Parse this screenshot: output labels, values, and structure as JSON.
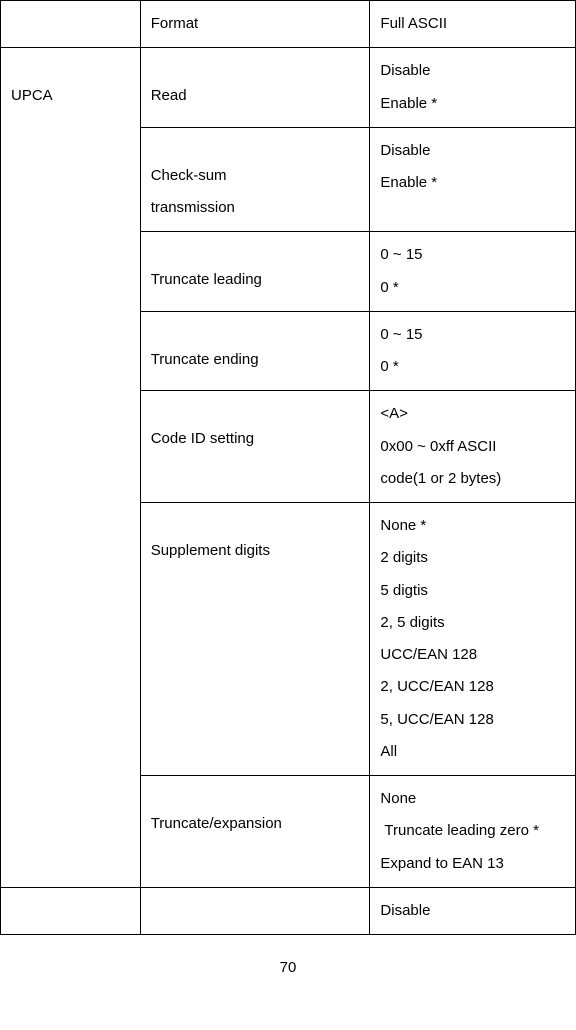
{
  "rows": [
    {
      "col1": "",
      "col2": "Format",
      "col3_lines": [
        " Full ASCII"
      ]
    },
    {
      "col1": "UPCA",
      "col1_rowspan": 7,
      "col2": "Read",
      "col3_lines": [
        "Disable",
        "Enable *"
      ]
    },
    {
      "col2_lines": [
        "Check-sum",
        "transmission"
      ],
      "col3_lines": [
        "Disable",
        "Enable *"
      ]
    },
    {
      "col2": "Truncate leading",
      "col3_lines": [
        "0 ~ 15",
        "0 *"
      ]
    },
    {
      "col2": "Truncate ending",
      "col3_lines": [
        "0 ~ 15",
        "0 *"
      ]
    },
    {
      "col2": "Code ID setting",
      "col3_lines": [
        "<A>",
        "0x00 ~ 0xff ASCII",
        "code(1 or 2 bytes)"
      ]
    },
    {
      "col2": "Supplement digits",
      "col3_lines": [
        " None *",
        " 2 digits",
        " 5 digtis",
        " 2, 5 digits",
        " UCC/EAN 128",
        " 2, UCC/EAN 128",
        " 5, UCC/EAN 128",
        " All"
      ]
    },
    {
      "col2": "Truncate/expansion",
      "col3_lines": [
        " None",
        " Truncate leading zero *",
        " Expand to EAN 13"
      ],
      "col3_special": true
    },
    {
      "col1": "",
      "col2": "",
      "col3_lines": [
        "Disable"
      ]
    }
  ],
  "page_number": "70"
}
